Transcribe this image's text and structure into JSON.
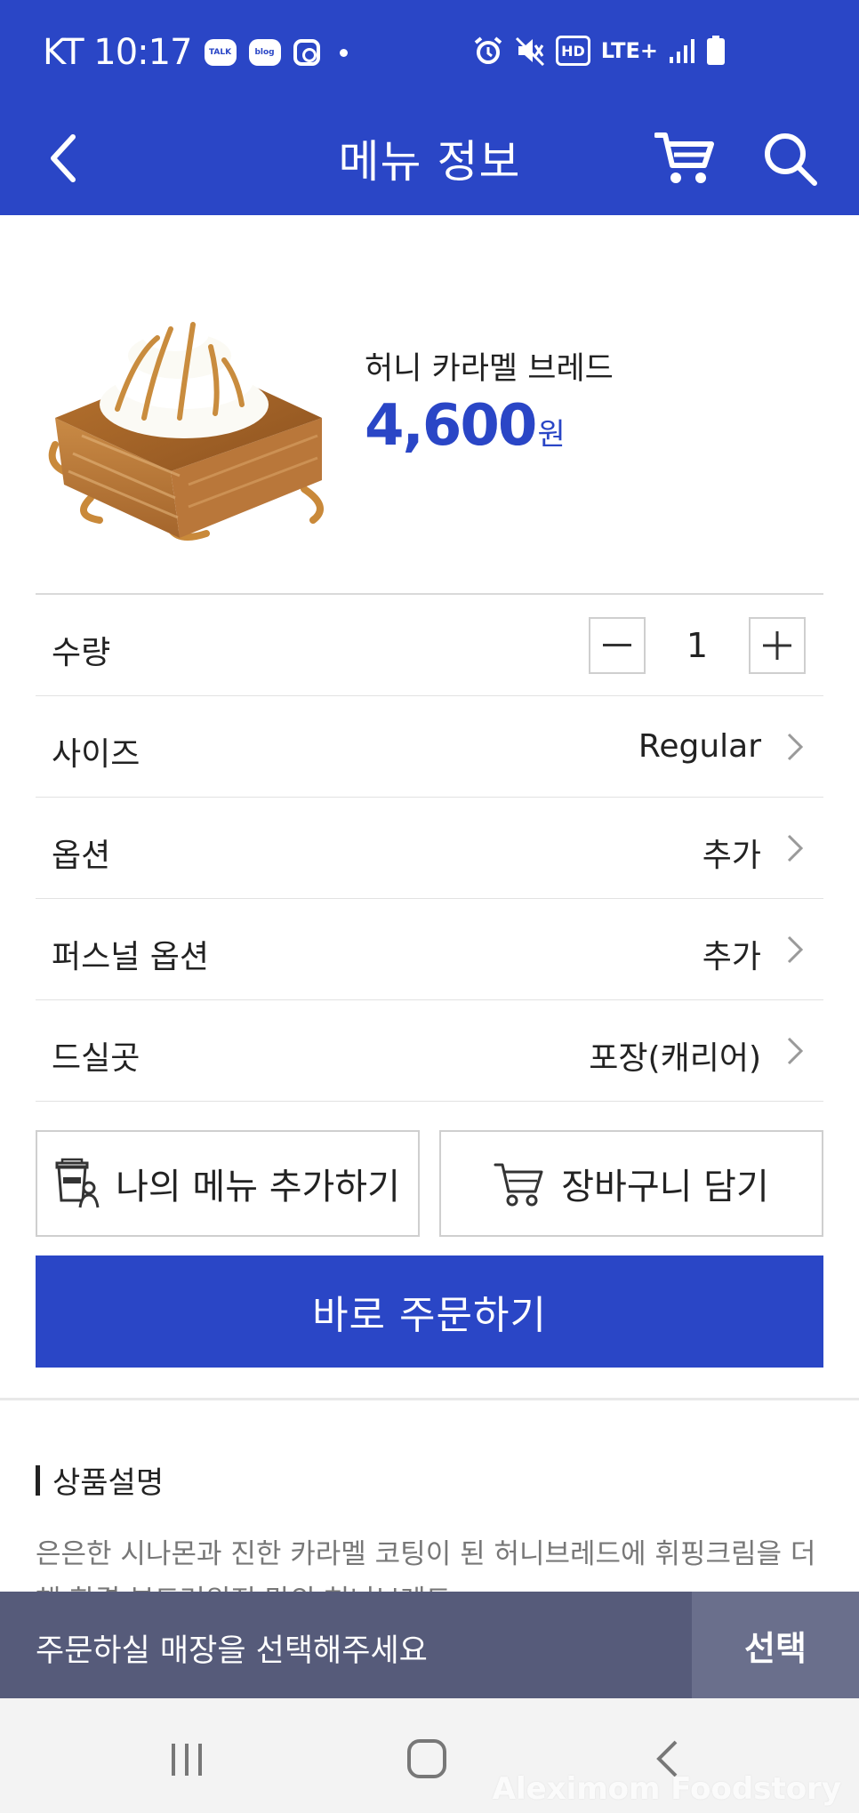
{
  "status_bar": {
    "carrier_time": "KT 10:17",
    "talk_label": "TALK",
    "blog_label": "blog",
    "hd_label": "HD",
    "network": "LTE+"
  },
  "header": {
    "title": "메뉴 정보",
    "color": "#2a46c6"
  },
  "product": {
    "name": "허니 카라멜 브레드",
    "price": "4,600",
    "currency": "원"
  },
  "options": {
    "quantity": {
      "label": "수량",
      "value": "1"
    },
    "size": {
      "label": "사이즈",
      "value": "Regular"
    },
    "option": {
      "label": "옵션",
      "value": "추가"
    },
    "personal_option": {
      "label": "퍼스널 옵션",
      "value": "추가"
    },
    "dining": {
      "label": "드실곳",
      "value": "포장(캐리어)"
    }
  },
  "actions": {
    "my_menu": "나의 메뉴 추가하기",
    "cart": "장바구니 담기",
    "order_now": "바로 주문하기"
  },
  "description": {
    "title": "상품설명",
    "text": "은은한 시나몬과 진한 카라멜 코팅이 된 허니브레드에 휘핑크림을 더해 한결 부드러워진 맛의 허니브레드"
  },
  "store_bar": {
    "text": "주문하실 매장을 선택해주세요",
    "button": "선택"
  },
  "watermark": "Aleximom Foodstory"
}
